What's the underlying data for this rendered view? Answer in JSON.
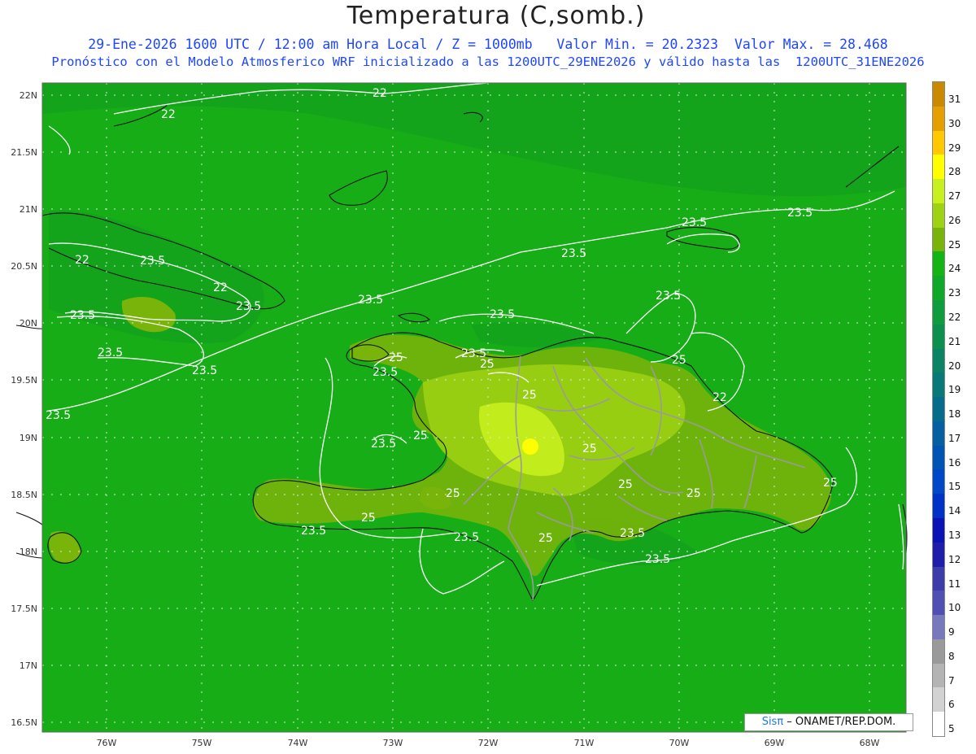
{
  "header": {
    "title": "Temperatura (C,somb.)",
    "subtitle1": "29-Ene-2026 1600 UTC / 12:00 am Hora Local / Z = 1000mb   Valor Min. = 20.2323  Valor Max. = 28.468",
    "subtitle2": "Pronóstico con el Modelo Atmosferico WRF inicializado a las 1200UTC_29ENE2026 y válido hasta las  1200UTC_31ENE2026"
  },
  "axes": {
    "lat_labels": [
      "22N",
      "21.5N",
      "21N",
      "20.5N",
      "20N",
      "19.5N",
      "19N",
      "18.5N",
      "18N",
      "17.5N",
      "17N",
      "16.5N"
    ],
    "lon_labels": [
      "76W",
      "75W",
      "74W",
      "73W",
      "72W",
      "71W",
      "70W",
      "69W",
      "68W"
    ]
  },
  "contour_labels": [
    "22",
    "22",
    "22",
    "22",
    "23.5",
    "23.5",
    "23.5",
    "23.5",
    "23.5",
    "23.5",
    "23.5",
    "23.5",
    "23.5",
    "23.5",
    "23.5",
    "23.5",
    "23.5",
    "23.5",
    "23.5",
    "23.5",
    "23.5",
    "23.5",
    "23.5",
    "25",
    "25",
    "25",
    "25",
    "25",
    "25",
    "25",
    "25",
    "25",
    "25",
    "25",
    "25"
  ],
  "colorbar": {
    "labels": [
      "31",
      "30",
      "29",
      "28",
      "27",
      "26",
      "25",
      "24",
      "23",
      "22",
      "21",
      "20",
      "19",
      "18",
      "17",
      "16",
      "15",
      "14",
      "13",
      "12",
      "11",
      "10",
      "9",
      "8",
      "7",
      "6",
      "5"
    ],
    "colors": [
      "#c98a00",
      "#e5a000",
      "#ffc800",
      "#ffff00",
      "#c8f01e",
      "#a0d214",
      "#78b40a",
      "#14b414",
      "#10a828",
      "#0e9c3c",
      "#0c9050",
      "#0a8464",
      "#087878",
      "#066c8c",
      "#0460a0",
      "#0254b4",
      "#0048c8",
      "#0032c8",
      "#0a14b4",
      "#1e1eaa",
      "#3c3caa",
      "#5050b4",
      "#7878be",
      "#9a9a9a",
      "#b4b4b4",
      "#d2d2d2",
      "#ffffff"
    ]
  },
  "credit": {
    "sis": "Sisπ",
    "org": " – ONAMET/REP.DOM."
  }
}
